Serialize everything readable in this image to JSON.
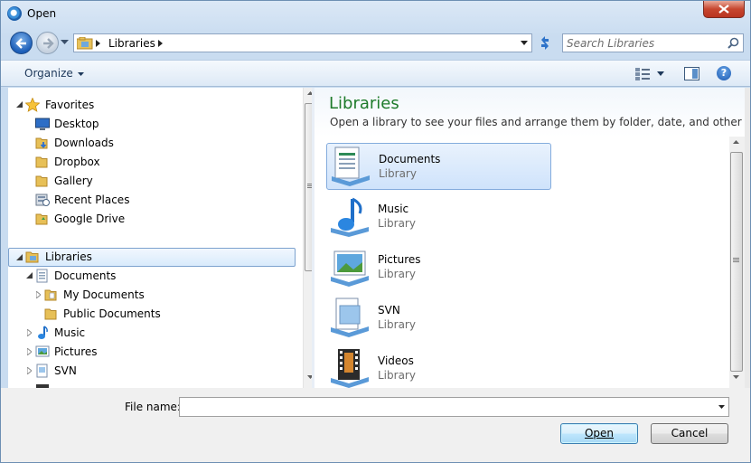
{
  "window": {
    "title": "Open"
  },
  "address": {
    "crumbs": [
      "Libraries"
    ]
  },
  "search": {
    "placeholder": "Search Libraries"
  },
  "toolbar": {
    "organize_label": "Organize",
    "help_label": "?"
  },
  "nav": {
    "favorites": {
      "label": "Favorites",
      "items": [
        {
          "label": "Desktop",
          "icon": "desktop-icon"
        },
        {
          "label": "Downloads",
          "icon": "downloads-folder-icon"
        },
        {
          "label": "Dropbox",
          "icon": "folder-icon"
        },
        {
          "label": "Gallery",
          "icon": "folder-icon"
        },
        {
          "label": "Recent Places",
          "icon": "recent-places-icon"
        },
        {
          "label": "Google Drive",
          "icon": "folder-icon"
        }
      ]
    },
    "libraries": {
      "label": "Libraries",
      "items": [
        {
          "label": "Documents",
          "icon": "documents-library-icon"
        },
        {
          "label": "My Documents",
          "icon": "folder-icon"
        },
        {
          "label": "Public Documents",
          "icon": "folder-icon"
        },
        {
          "label": "Music",
          "icon": "music-library-icon"
        },
        {
          "label": "Pictures",
          "icon": "pictures-library-icon"
        },
        {
          "label": "SVN",
          "icon": "svn-library-icon"
        }
      ]
    }
  },
  "content": {
    "title": "Libraries",
    "subtitle": "Open a library to see your files and arrange them by folder, date, and other prop...",
    "items": [
      {
        "name": "Documents",
        "type": "Library",
        "icon": "documents-library-icon",
        "selected": true
      },
      {
        "name": "Music",
        "type": "Library",
        "icon": "music-library-icon"
      },
      {
        "name": "Pictures",
        "type": "Library",
        "icon": "pictures-library-icon"
      },
      {
        "name": "SVN",
        "type": "Library",
        "icon": "svn-library-icon"
      },
      {
        "name": "Videos",
        "type": "Library",
        "icon": "videos-library-icon"
      }
    ]
  },
  "footer": {
    "filename_label": "File name:",
    "filename_value": "",
    "open_label": "Open",
    "cancel_label": "Cancel"
  },
  "colors": {
    "library_title": "#1e7b2a",
    "selection": "#cfe3fb",
    "selection_border": "#84acdd"
  }
}
